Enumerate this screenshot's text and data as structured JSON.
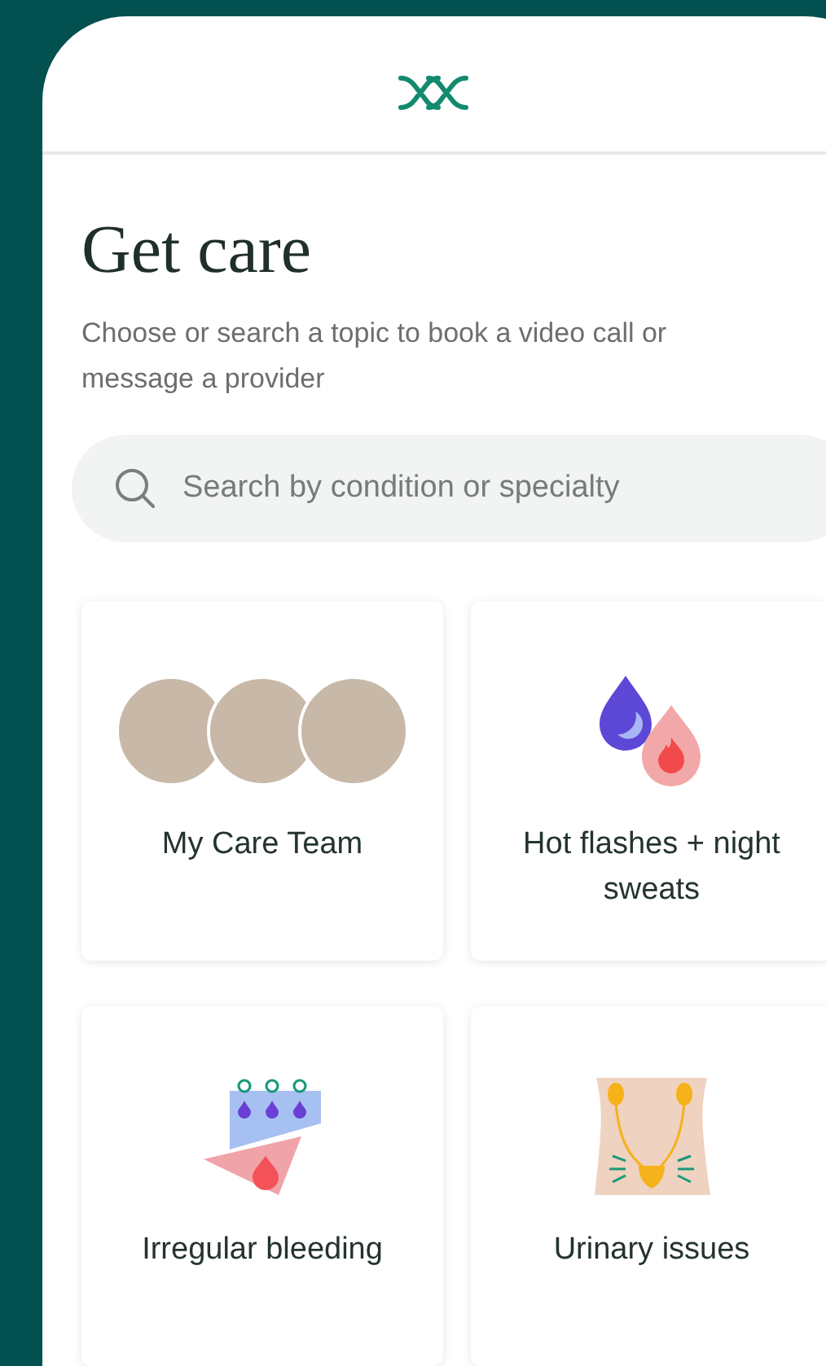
{
  "page": {
    "title": "Get care",
    "subtitle": "Choose or search a topic to book a video call or message a provider"
  },
  "search": {
    "placeholder": "Search by condition or specialty"
  },
  "topics": [
    {
      "kind": "team",
      "label": "My Care Team"
    },
    {
      "kind": "sweats",
      "label": "Hot flashes + night sweats"
    },
    {
      "kind": "bleeding",
      "label": "Irregular bleeding"
    },
    {
      "kind": "urinary",
      "label": "Urinary issues"
    }
  ]
}
